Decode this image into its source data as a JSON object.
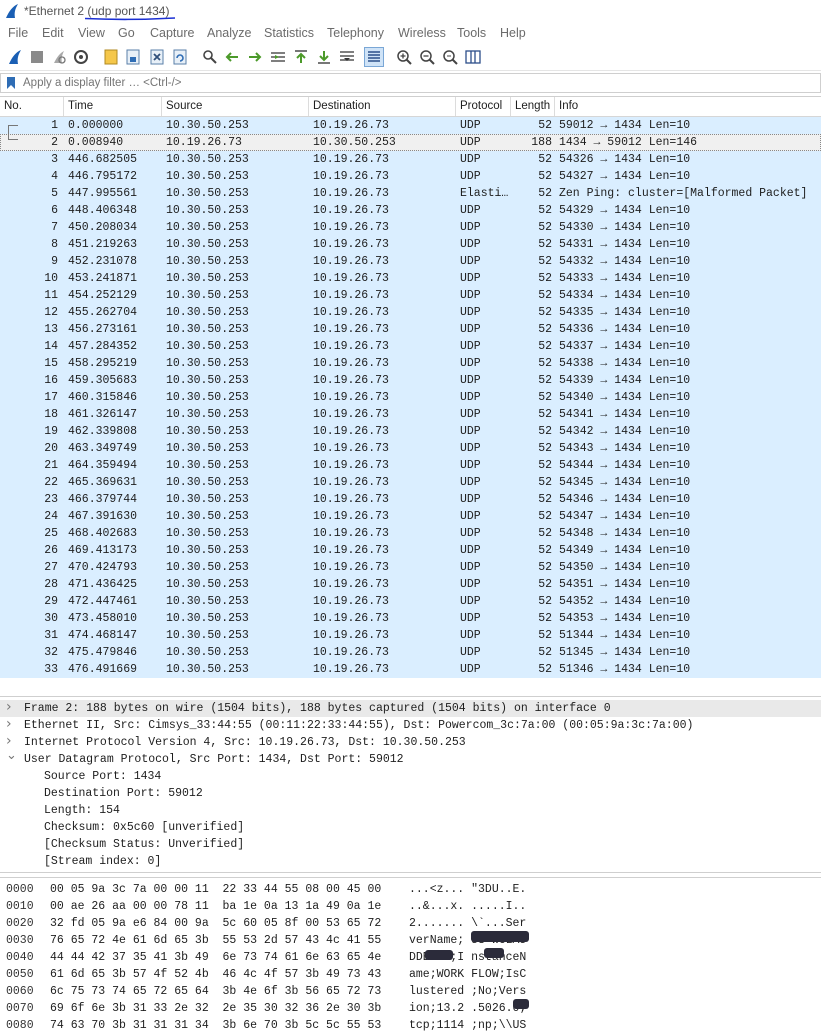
{
  "window": {
    "title_prefix": "*Ethernet 2 (",
    "title_filter": "udp port 1434",
    "title_suffix": ")"
  },
  "menu": [
    "File",
    "Edit",
    "View",
    "Go",
    "Capture",
    "Analyze",
    "Statistics",
    "Telephony",
    "Wireless",
    "Tools",
    "Help"
  ],
  "filter": {
    "placeholder": "Apply a display filter … <Ctrl-/>"
  },
  "columns": {
    "no": "No.",
    "time": "Time",
    "source": "Source",
    "destination": "Destination",
    "protocol": "Protocol",
    "length": "Length",
    "info": "Info"
  },
  "packets": [
    [
      "1",
      "0.000000",
      "10.30.50.253",
      "10.19.26.73",
      "UDP",
      "52",
      "59012 → 1434 Len=10"
    ],
    [
      "2",
      "0.008940",
      "10.19.26.73",
      "10.30.50.253",
      "UDP",
      "188",
      "1434 → 59012 Len=146"
    ],
    [
      "3",
      "446.682505",
      "10.30.50.253",
      "10.19.26.73",
      "UDP",
      "52",
      "54326 → 1434 Len=10"
    ],
    [
      "4",
      "446.795172",
      "10.30.50.253",
      "10.19.26.73",
      "UDP",
      "52",
      "54327 → 1434 Len=10"
    ],
    [
      "5",
      "447.995561",
      "10.30.50.253",
      "10.19.26.73",
      "Elasti…",
      "52",
      "Zen Ping: cluster=[Malformed Packet]"
    ],
    [
      "6",
      "448.406348",
      "10.30.50.253",
      "10.19.26.73",
      "UDP",
      "52",
      "54329 → 1434 Len=10"
    ],
    [
      "7",
      "450.208034",
      "10.30.50.253",
      "10.19.26.73",
      "UDP",
      "52",
      "54330 → 1434 Len=10"
    ],
    [
      "8",
      "451.219263",
      "10.30.50.253",
      "10.19.26.73",
      "UDP",
      "52",
      "54331 → 1434 Len=10"
    ],
    [
      "9",
      "452.231078",
      "10.30.50.253",
      "10.19.26.73",
      "UDP",
      "52",
      "54332 → 1434 Len=10"
    ],
    [
      "10",
      "453.241871",
      "10.30.50.253",
      "10.19.26.73",
      "UDP",
      "52",
      "54333 → 1434 Len=10"
    ],
    [
      "11",
      "454.252129",
      "10.30.50.253",
      "10.19.26.73",
      "UDP",
      "52",
      "54334 → 1434 Len=10"
    ],
    [
      "12",
      "455.262704",
      "10.30.50.253",
      "10.19.26.73",
      "UDP",
      "52",
      "54335 → 1434 Len=10"
    ],
    [
      "13",
      "456.273161",
      "10.30.50.253",
      "10.19.26.73",
      "UDP",
      "52",
      "54336 → 1434 Len=10"
    ],
    [
      "14",
      "457.284352",
      "10.30.50.253",
      "10.19.26.73",
      "UDP",
      "52",
      "54337 → 1434 Len=10"
    ],
    [
      "15",
      "458.295219",
      "10.30.50.253",
      "10.19.26.73",
      "UDP",
      "52",
      "54338 → 1434 Len=10"
    ],
    [
      "16",
      "459.305683",
      "10.30.50.253",
      "10.19.26.73",
      "UDP",
      "52",
      "54339 → 1434 Len=10"
    ],
    [
      "17",
      "460.315846",
      "10.30.50.253",
      "10.19.26.73",
      "UDP",
      "52",
      "54340 → 1434 Len=10"
    ],
    [
      "18",
      "461.326147",
      "10.30.50.253",
      "10.19.26.73",
      "UDP",
      "52",
      "54341 → 1434 Len=10"
    ],
    [
      "19",
      "462.339808",
      "10.30.50.253",
      "10.19.26.73",
      "UDP",
      "52",
      "54342 → 1434 Len=10"
    ],
    [
      "20",
      "463.349749",
      "10.30.50.253",
      "10.19.26.73",
      "UDP",
      "52",
      "54343 → 1434 Len=10"
    ],
    [
      "21",
      "464.359494",
      "10.30.50.253",
      "10.19.26.73",
      "UDP",
      "52",
      "54344 → 1434 Len=10"
    ],
    [
      "22",
      "465.369631",
      "10.30.50.253",
      "10.19.26.73",
      "UDP",
      "52",
      "54345 → 1434 Len=10"
    ],
    [
      "23",
      "466.379744",
      "10.30.50.253",
      "10.19.26.73",
      "UDP",
      "52",
      "54346 → 1434 Len=10"
    ],
    [
      "24",
      "467.391630",
      "10.30.50.253",
      "10.19.26.73",
      "UDP",
      "52",
      "54347 → 1434 Len=10"
    ],
    [
      "25",
      "468.402683",
      "10.30.50.253",
      "10.19.26.73",
      "UDP",
      "52",
      "54348 → 1434 Len=10"
    ],
    [
      "26",
      "469.413173",
      "10.30.50.253",
      "10.19.26.73",
      "UDP",
      "52",
      "54349 → 1434 Len=10"
    ],
    [
      "27",
      "470.424793",
      "10.30.50.253",
      "10.19.26.73",
      "UDP",
      "52",
      "54350 → 1434 Len=10"
    ],
    [
      "28",
      "471.436425",
      "10.30.50.253",
      "10.19.26.73",
      "UDP",
      "52",
      "54351 → 1434 Len=10"
    ],
    [
      "29",
      "472.447461",
      "10.30.50.253",
      "10.19.26.73",
      "UDP",
      "52",
      "54352 → 1434 Len=10"
    ],
    [
      "30",
      "473.458010",
      "10.30.50.253",
      "10.19.26.73",
      "UDP",
      "52",
      "54353 → 1434 Len=10"
    ],
    [
      "31",
      "474.468147",
      "10.30.50.253",
      "10.19.26.73",
      "UDP",
      "52",
      "51344 → 1434 Len=10"
    ],
    [
      "32",
      "475.479846",
      "10.30.50.253",
      "10.19.26.73",
      "UDP",
      "52",
      "51345 → 1434 Len=10"
    ],
    [
      "33",
      "476.491669",
      "10.30.50.253",
      "10.19.26.73",
      "UDP",
      "52",
      "51346 → 1434 Len=10"
    ]
  ],
  "selected_packet": "2",
  "details": [
    {
      "text": "Frame 2: 188 bytes on wire (1504 bits), 188 bytes captured (1504 bits) on interface 0",
      "indent": 0,
      "state": "collapsed"
    },
    {
      "text": "Ethernet II, Src: Cimsys_33:44:55 (00:11:22:33:44:55), Dst: Powercom_3c:7a:00 (00:05:9a:3c:7a:00)",
      "indent": 0,
      "state": "collapsed"
    },
    {
      "text": "Internet Protocol Version 4, Src: 10.19.26.73, Dst: 10.30.50.253",
      "indent": 0,
      "state": "collapsed"
    },
    {
      "text": "User Datagram Protocol, Src Port: 1434, Dst Port: 59012",
      "indent": 0,
      "state": "expanded"
    },
    {
      "text": "Source Port: 1434",
      "indent": 1,
      "state": "leaf"
    },
    {
      "text": "Destination Port: 59012",
      "indent": 1,
      "state": "leaf"
    },
    {
      "text": "Length: 154",
      "indent": 1,
      "state": "leaf"
    },
    {
      "text": "Checksum: 0x5c60 [unverified]",
      "indent": 1,
      "state": "leaf"
    },
    {
      "text": "[Checksum Status: Unverified]",
      "indent": 1,
      "state": "leaf"
    },
    {
      "text": "[Stream index: 0]",
      "indent": 1,
      "state": "leaf"
    }
  ],
  "bytes": [
    {
      "offset": "0000",
      "hex": "00 05 9a 3c 7a 00 00 11  22 33 44 55 08 00 45 00",
      "ascii": "...<z... \"3DU..E."
    },
    {
      "offset": "0010",
      "hex": "00 ae 26 aa 00 00 78 11  ba 1e 0a 13 1a 49 0a 1e",
      "ascii": "..&...x. .....I.."
    },
    {
      "offset": "0020",
      "hex": "32 fd 05 9a e6 84 00 9a  5c 60 05 8f 00 53 65 72",
      "ascii": "2....... \\`...Ser"
    },
    {
      "offset": "0030",
      "hex": "76 65 72 4e 61 6d 65 3b  55 53 2d 57 43 4c 41 55",
      "ascii": "verName; US-WCLAU"
    },
    {
      "offset": "0040",
      "hex": "44 44 42 37 35 41 3b 49  6e 73 74 61 6e 63 65 4e",
      "ascii": "DDB75A;I nstanceN"
    },
    {
      "offset": "0050",
      "hex": "61 6d 65 3b 57 4f 52 4b  46 4c 4f 57 3b 49 73 43",
      "ascii": "ame;WORK FLOW;IsC"
    },
    {
      "offset": "0060",
      "hex": "6c 75 73 74 65 72 65 64  3b 4e 6f 3b 56 65 72 73",
      "ascii": "lustered ;No;Vers"
    },
    {
      "offset": "0070",
      "hex": "69 6f 6e 3b 31 33 2e 32  2e 35 30 32 36 2e 30 3b",
      "ascii": "ion;13.2 .5026.0;"
    },
    {
      "offset": "0080",
      "hex": "74 63 70 3b 31 31 31 34  3b 6e 70 3b 5c 5c 55 53",
      "ascii": "tcp;1114 ;np;\\\\US"
    }
  ],
  "colors": {
    "row_bg": "#daeeff",
    "selected_bg": "#f0f0f0",
    "accent": "#1a5fb4"
  }
}
